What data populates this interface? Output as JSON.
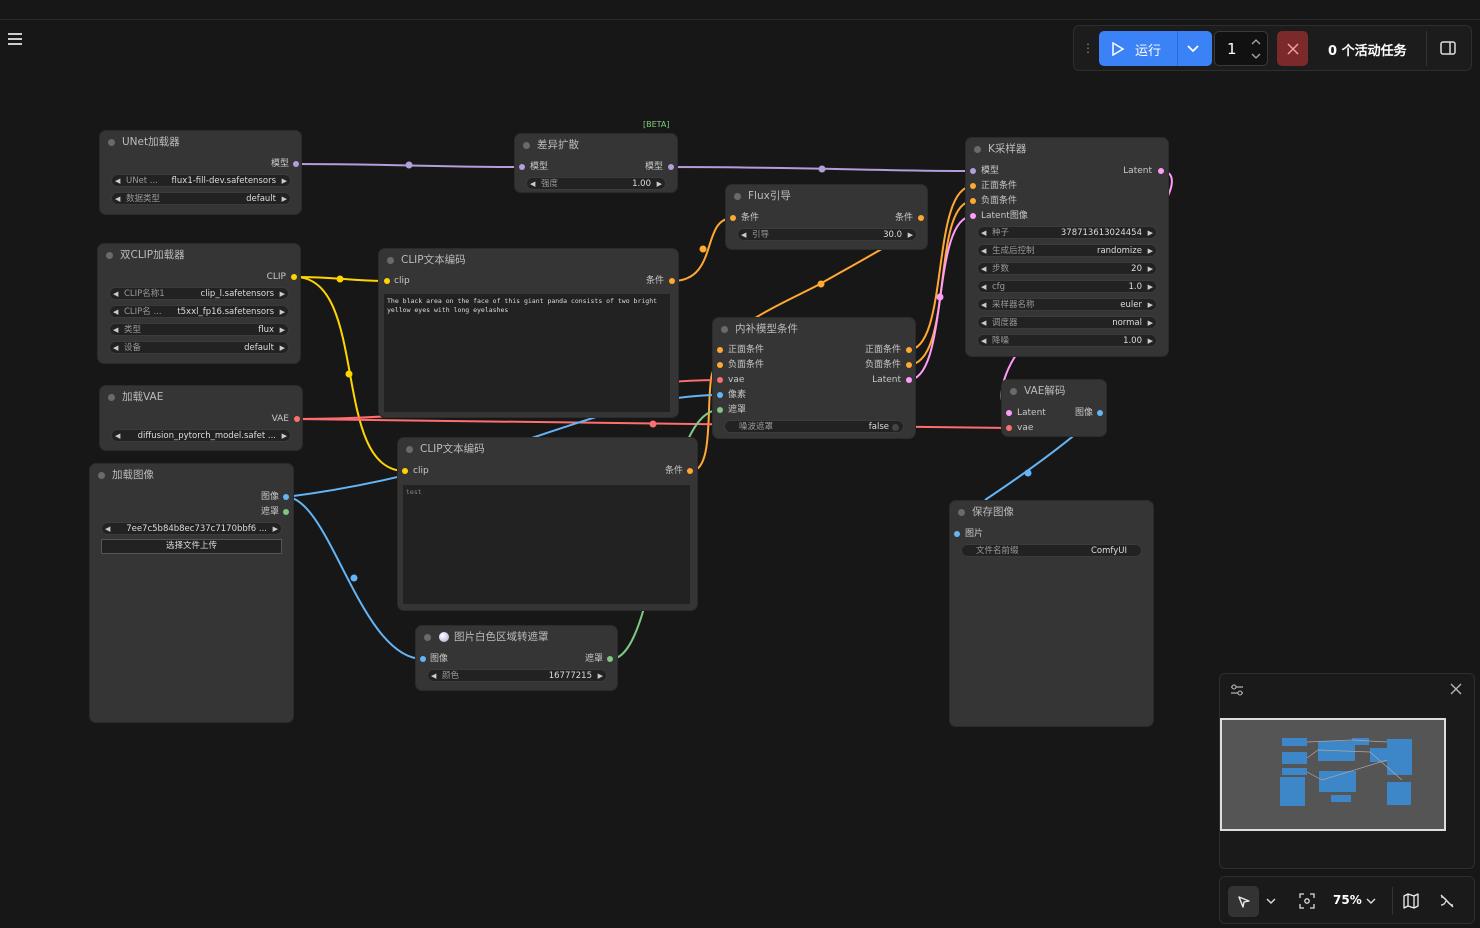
{
  "menu_icon": "hamburger-menu-icon",
  "toolbar": {
    "run_label": "运行",
    "run_icon": "play-icon",
    "batch_count": "1",
    "active_tasks": "0 个活动任务",
    "cancel_icon": "close-icon",
    "panel_icon": "side-panel-icon"
  },
  "beta_tag": "[BETA]",
  "nodes": {
    "unet": {
      "title": "UNet加载器",
      "out_model": "模型",
      "w_unet_label": "UNet ...",
      "w_unet_value": "flux1-fill-dev.safetensors",
      "w_dtype_label": "数据类型",
      "w_dtype_value": "default"
    },
    "diff": {
      "title": "差异扩散",
      "in_model": "模型",
      "out_model": "模型",
      "w_strength_label": "强度",
      "w_strength_value": "1.00"
    },
    "flux": {
      "title": "Flux引导",
      "in_cond": "条件",
      "out_cond": "条件",
      "w_guid_label": "引导",
      "w_guid_value": "30.0"
    },
    "ksampler": {
      "title": "K采样器",
      "in_model": "模型",
      "in_pos": "正面条件",
      "in_neg": "负面条件",
      "in_latent": "Latent图像",
      "out_latent": "Latent",
      "w_seed_label": "种子",
      "w_seed_value": "378713613024454",
      "w_ctrl_label": "生成后控制",
      "w_ctrl_value": "randomize",
      "w_steps_label": "步数",
      "w_steps_value": "20",
      "w_cfg_label": "cfg",
      "w_cfg_value": "1.0",
      "w_sampler_label": "采样器名称",
      "w_sampler_value": "euler",
      "w_sched_label": "调度器",
      "w_sched_value": "normal",
      "w_denoise_label": "降噪",
      "w_denoise_value": "1.00"
    },
    "dualclip": {
      "title": "双CLIP加载器",
      "out_clip": "CLIP",
      "w_clip1_label": "CLIP名称1",
      "w_clip1_value": "clip_l.safetensors",
      "w_clip2_label": "CLIP名 ...",
      "w_clip2_value": "t5xxl_fp16.safetensors",
      "w_type_label": "类型",
      "w_type_value": "flux",
      "w_device_label": "设备",
      "w_device_value": "default"
    },
    "clip1": {
      "title": "CLIP文本编码",
      "in_clip": "clip",
      "out_cond": "条件",
      "text": "The black area on the face of this giant panda consists of two bright yellow eyes with long eyelashes"
    },
    "inpaint": {
      "title": "内补模型条件",
      "in_pos": "正面条件",
      "in_neg": "负面条件",
      "in_vae": "vae",
      "in_pixels": "像素",
      "in_mask": "遮罩",
      "out_pos": "正面条件",
      "out_neg": "负面条件",
      "out_latent": "Latent",
      "w_noise_label": "噪波遮罩",
      "w_noise_value": "false"
    },
    "vae_loader": {
      "title": "加载VAE",
      "out_vae": "VAE",
      "w_vae_value": "diffusion_pytorch_model.safet ..."
    },
    "vae_decode": {
      "title": "VAE解码",
      "in_latent": "Latent",
      "in_vae": "vae",
      "out_image": "图像"
    },
    "load_image": {
      "title": "加载图像",
      "out_image": "图像",
      "out_mask": "遮罩",
      "w_image_value": "7ee7c5b84b8ec737c7170bbf6 ...",
      "upload_label": "选择文件上传"
    },
    "clip2": {
      "title": "CLIP文本编码",
      "in_clip": "clip",
      "out_cond": "条件",
      "text": "test"
    },
    "save_image": {
      "title": "保存图像",
      "in_images": "图片",
      "w_prefix_label": "文件名前缀",
      "w_prefix_value": "ComfyUI"
    },
    "white_mask": {
      "title": "图片白色区域转遮罩",
      "in_image": "图像",
      "out_mask": "遮罩",
      "w_color_label": "颜色",
      "w_color_value": "16777215"
    }
  },
  "minimap": {
    "settings_icon": "sliders-icon",
    "close_icon": "close-icon"
  },
  "bottom": {
    "select_icon": "pointer-icon",
    "fit_icon": "focus-icon",
    "zoom": "75%",
    "map_icon": "map-icon",
    "links_icon": "hide-links-icon"
  },
  "colors": {
    "model": "#b39ddb",
    "clip": "#ffd500",
    "conditioning": "#ffa931",
    "vae": "#ff6e6e",
    "image": "#64b5f6",
    "mask": "#81c784",
    "latent": "#ff9cf9",
    "run_button": "#3b82f6"
  }
}
